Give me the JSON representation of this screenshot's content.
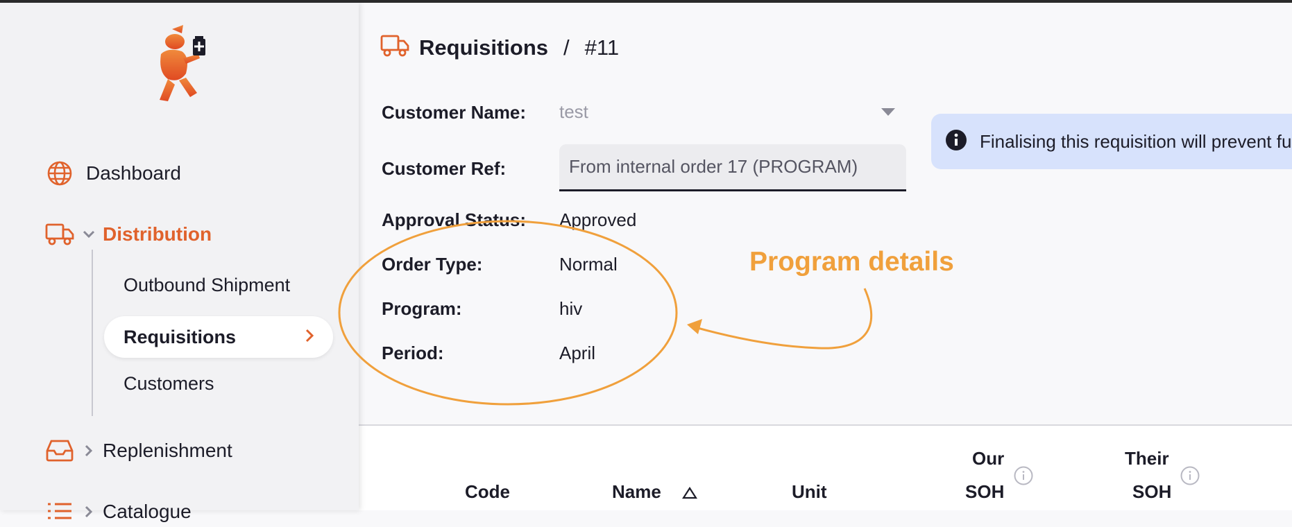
{
  "sidebar": {
    "items": [
      {
        "label": "Dashboard",
        "icon": "globe-icon"
      },
      {
        "label": "Distribution",
        "icon": "truck-icon",
        "expanded": true
      },
      {
        "label": "Replenishment",
        "icon": "inbox-icon"
      },
      {
        "label": "Catalogue",
        "icon": "list-icon"
      }
    ],
    "distribution_children": [
      "Outbound Shipment",
      "Requisitions",
      "Customers"
    ]
  },
  "breadcrumb": {
    "section": "Requisitions",
    "separator": "/",
    "id": "#11"
  },
  "details": {
    "customer_name_label": "Customer Name:",
    "customer_name_value": "test",
    "customer_ref_label": "Customer Ref:",
    "customer_ref_value": "From internal order 17 (PROGRAM)",
    "approval_status_label": "Approval Status:",
    "approval_status_value": "Approved",
    "order_type_label": "Order Type:",
    "order_type_value": "Normal",
    "program_label": "Program:",
    "program_value": "hiv",
    "period_label": "Period:",
    "period_value": "April"
  },
  "alert": {
    "text": "Finalising this requisition will prevent further changes."
  },
  "annotation": {
    "text": "Program details"
  },
  "table": {
    "headers": [
      "Code",
      "Name",
      "Unit",
      "Our",
      "SOH",
      "Their",
      "SOH"
    ]
  },
  "colors": {
    "accent": "#e0622c",
    "annotation": "#f0a03c",
    "alert_bg": "#d7e2fc"
  }
}
